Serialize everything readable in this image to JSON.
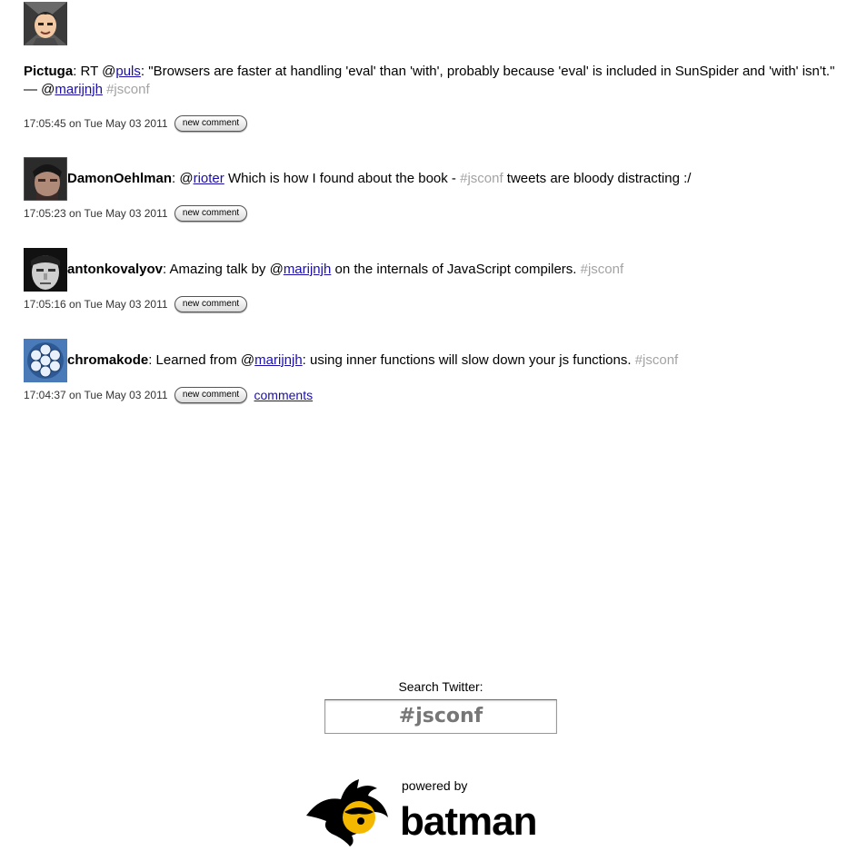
{
  "tweets": [
    {
      "user": "Pictuga",
      "parts": [
        {
          "t": "text",
          "v": ": RT @"
        },
        {
          "t": "link",
          "v": "puls"
        },
        {
          "t": "text",
          "v": ": \"Browsers are faster at handling 'eval' than 'with', probably because 'eval' is included in SunSpider and 'with' isn't.\" — @"
        },
        {
          "t": "link",
          "v": "marijnjh"
        },
        {
          "t": "text",
          "v": " "
        },
        {
          "t": "hashtag",
          "v": "#jsconf"
        }
      ],
      "timestamp": "17:05:45 on Tue May 03 2011",
      "button": "new comment"
    },
    {
      "user": "DamonOehlman",
      "parts": [
        {
          "t": "text",
          "v": ": @"
        },
        {
          "t": "link",
          "v": "rioter"
        },
        {
          "t": "text",
          "v": " Which is how I found about the book - "
        },
        {
          "t": "hashtag",
          "v": "#jsconf"
        },
        {
          "t": "text",
          "v": " tweets are bloody distracting :/"
        }
      ],
      "timestamp": "17:05:23 on Tue May 03 2011",
      "button": "new comment"
    },
    {
      "user": "antonkovalyov",
      "parts": [
        {
          "t": "text",
          "v": ": Amazing talk by @"
        },
        {
          "t": "link",
          "v": "marijnjh"
        },
        {
          "t": "text",
          "v": " on the internals of JavaScript compilers. "
        },
        {
          "t": "hashtag",
          "v": "#jsconf"
        }
      ],
      "timestamp": "17:05:16 on Tue May 03 2011",
      "button": "new comment"
    },
    {
      "user": "chromakode",
      "parts": [
        {
          "t": "text",
          "v": ": Learned from @"
        },
        {
          "t": "link",
          "v": "marijnjh"
        },
        {
          "t": "text",
          "v": ": using inner functions will slow down your js functions. "
        },
        {
          "t": "hashtag",
          "v": "#jsconf"
        }
      ],
      "timestamp": "17:04:37 on Tue May 03 2011",
      "button": "new comment",
      "comments_link": "comments"
    }
  ],
  "search": {
    "label": "Search Twitter:",
    "value": "#jsconf"
  },
  "footer": {
    "powered_by": "powered by",
    "brand": "batman"
  },
  "colors": {
    "link": "#1a0dab",
    "hashtag": "#a3a3a3",
    "logo_yellow": "#f5b800"
  }
}
